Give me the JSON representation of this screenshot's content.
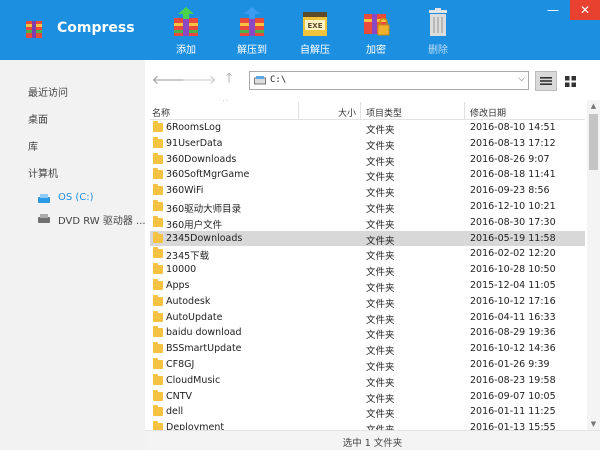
{
  "app": {
    "title": "Compress"
  },
  "window_controls": {
    "minimize": "—",
    "close": "✕"
  },
  "ribbon": [
    {
      "label": "添加",
      "icon": "add-archive-icon",
      "enabled": true
    },
    {
      "label": "解压到",
      "icon": "extract-to-icon",
      "enabled": true
    },
    {
      "label": "自解压",
      "icon": "self-extract-exe-icon",
      "enabled": true
    },
    {
      "label": "加密",
      "icon": "encrypt-lock-icon",
      "enabled": true
    },
    {
      "label": "删除",
      "icon": "trash-icon",
      "enabled": false
    }
  ],
  "sidebar": {
    "recent": "最近访问",
    "desktop": "桌面",
    "library": "库",
    "computer": "计算机",
    "drives": [
      {
        "label": "OS (C:)",
        "icon": "hard-drive-icon",
        "selected": true
      },
      {
        "label": "DVD RW 驱动器 ...",
        "icon": "dvd-drive-icon",
        "selected": false
      }
    ]
  },
  "toolbar": {
    "back": "🡐",
    "forward": "🡒",
    "up": "🡑",
    "path": "C:\\",
    "dropdown": "⌵"
  },
  "columns": {
    "name": "名称",
    "size": "大小",
    "type": "项目类型",
    "modified": "修改日期",
    "sort_arrow": "^"
  },
  "files": [
    {
      "name": "6RoomsLog",
      "type": "文件夹",
      "modified": "2016-08-10 14:51"
    },
    {
      "name": "91UserData",
      "type": "文件夹",
      "modified": "2016-08-13 17:12"
    },
    {
      "name": "360Downloads",
      "type": "文件夹",
      "modified": "2016-08-26 9:07"
    },
    {
      "name": "360SoftMgrGame",
      "type": "文件夹",
      "modified": "2016-08-18 11:41"
    },
    {
      "name": "360WiFi",
      "type": "文件夹",
      "modified": "2016-09-23 8:56"
    },
    {
      "name": "360驱动大师目录",
      "type": "文件夹",
      "modified": "2016-12-10 10:21"
    },
    {
      "name": "360用户文件",
      "type": "文件夹",
      "modified": "2016-08-30 17:30"
    },
    {
      "name": "2345Downloads",
      "type": "文件夹",
      "modified": "2016-05-19 11:58",
      "selected": true
    },
    {
      "name": "2345下载",
      "type": "文件夹",
      "modified": "2016-02-02 12:20"
    },
    {
      "name": "10000",
      "type": "文件夹",
      "modified": "2016-10-28 10:50"
    },
    {
      "name": "Apps",
      "type": "文件夹",
      "modified": "2015-12-04 11:05"
    },
    {
      "name": "Autodesk",
      "type": "文件夹",
      "modified": "2016-10-12 17:16"
    },
    {
      "name": "AutoUpdate",
      "type": "文件夹",
      "modified": "2016-04-11 16:33"
    },
    {
      "name": "baidu download",
      "type": "文件夹",
      "modified": "2016-08-29 19:36"
    },
    {
      "name": "BSSmartUpdate",
      "type": "文件夹",
      "modified": "2016-10-12 14:36"
    },
    {
      "name": "CF8GJ",
      "type": "文件夹",
      "modified": "2016-01-26 9:39"
    },
    {
      "name": "CloudMusic",
      "type": "文件夹",
      "modified": "2016-08-23 19:58"
    },
    {
      "name": "CNTV",
      "type": "文件夹",
      "modified": "2016-09-07 10:05"
    },
    {
      "name": "dell",
      "type": "文件夹",
      "modified": "2016-01-11 11:25"
    },
    {
      "name": "Deployment",
      "type": "文件夹",
      "modified": "2016-01-13 15:55"
    }
  ],
  "scrollbar": {
    "up": "▲",
    "down": "▼"
  },
  "status": {
    "text": "选中 1 文件夹"
  },
  "colors": {
    "brand": "#1d8fe0",
    "folder": "#f5c242",
    "selected_row": "#d8d8d8",
    "sidebar_bg": "#f2f2f2"
  }
}
